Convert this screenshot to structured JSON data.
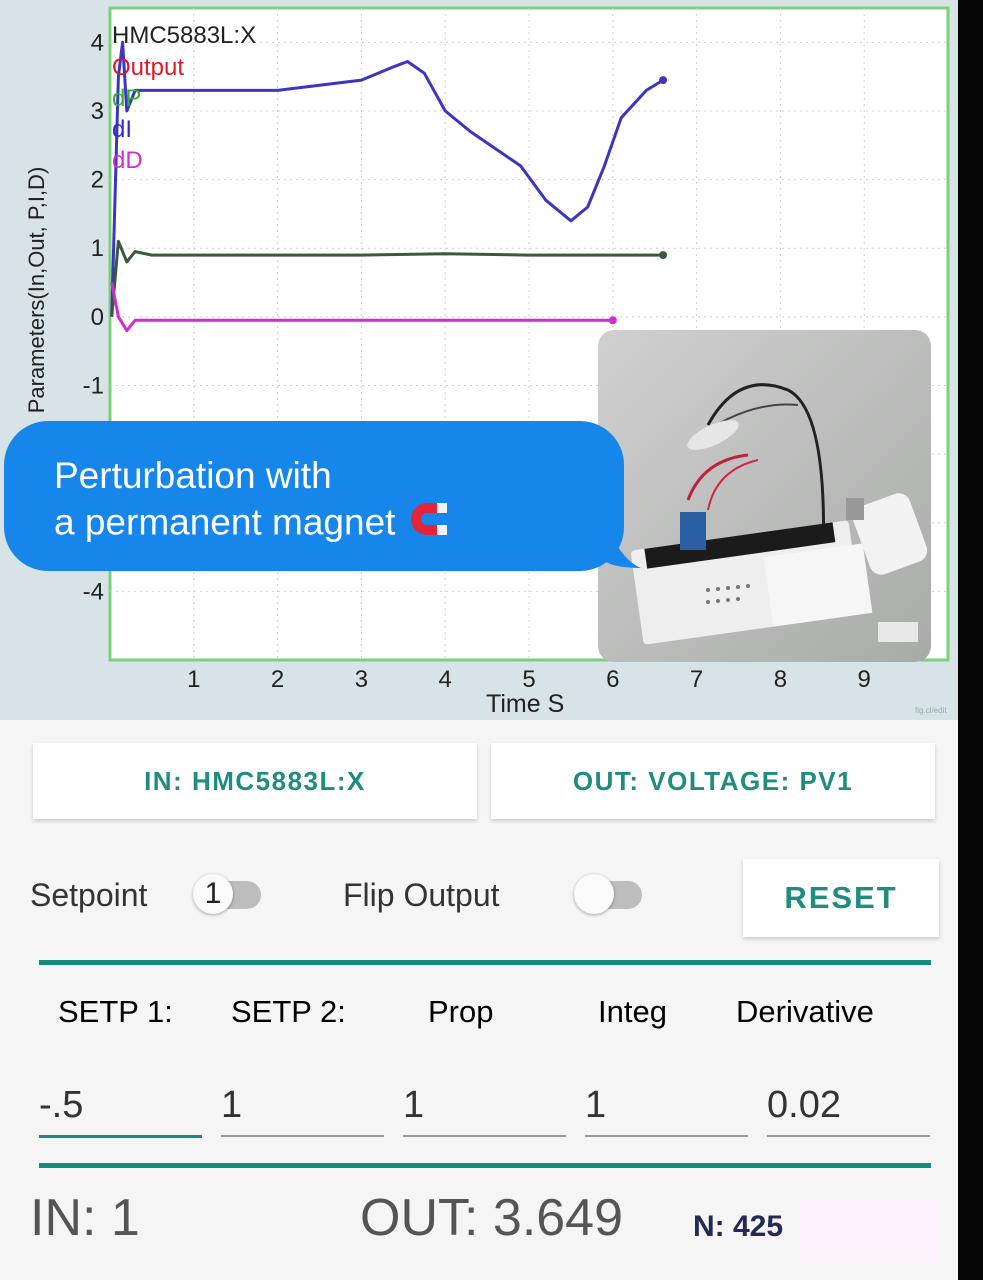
{
  "chart": {
    "title": "HMC5883L:X",
    "legend": [
      {
        "label": "Output",
        "color": "#e0182a"
      },
      {
        "label": "dP",
        "color": "#34b034"
      },
      {
        "label": "dI",
        "color": "#2c2cc8"
      },
      {
        "label": "dD",
        "color": "#d42ad4"
      }
    ],
    "ylabel": "Parameters(In,Out, P,I,D)",
    "xlabel": "Time S",
    "watermark": "fig.cl/edit",
    "xticks": [
      "1",
      "2",
      "3",
      "4",
      "5",
      "6",
      "7",
      "8",
      "9"
    ],
    "yticks": [
      "4",
      "3",
      "2",
      "1",
      "0",
      "-1",
      "-4"
    ],
    "grid": true
  },
  "chart_data": {
    "type": "line",
    "title": "HMC5883L:X",
    "xlabel": "Time S",
    "ylabel": "Parameters(In,Out, P,I,D)",
    "xlim": [
      0,
      10
    ],
    "ylim": [
      -5,
      4.5
    ],
    "series": [
      {
        "name": "Output",
        "color": "#3b35c0",
        "x": [
          0.02,
          0.1,
          0.15,
          0.2,
          0.3,
          0.5,
          1,
          2,
          3,
          3.4,
          3.55,
          3.75,
          4,
          4.3,
          4.6,
          4.9,
          5.2,
          5.5,
          5.7,
          5.9,
          6.1,
          6.4,
          6.6
        ],
        "y": [
          0,
          3.5,
          4.0,
          3.0,
          3.3,
          3.3,
          3.3,
          3.3,
          3.45,
          3.65,
          3.72,
          3.55,
          3.0,
          2.7,
          2.45,
          2.2,
          1.7,
          1.4,
          1.6,
          2.2,
          2.9,
          3.3,
          3.45
        ]
      },
      {
        "name": "dP",
        "color": "#3a5a3a",
        "x": [
          0.02,
          0.1,
          0.2,
          0.3,
          0.5,
          1,
          2,
          3,
          4,
          5,
          6,
          6.6
        ],
        "y": [
          0,
          1.1,
          0.8,
          0.95,
          0.9,
          0.9,
          0.9,
          0.9,
          0.92,
          0.9,
          0.9,
          0.9
        ]
      },
      {
        "name": "dD",
        "color": "#d42ad4",
        "x": [
          0.02,
          0.1,
          0.2,
          0.3,
          0.5,
          1,
          2,
          3,
          4,
          5,
          6
        ],
        "y": [
          0.5,
          0.0,
          -0.2,
          -0.05,
          -0.05,
          -0.05,
          -0.05,
          -0.05,
          -0.05,
          -0.05,
          -0.05
        ]
      }
    ]
  },
  "overlay": {
    "bubble_line1": "Perturbation with",
    "bubble_line2": "a permanent magnet",
    "icon": "magnet-icon"
  },
  "io": {
    "input": "IN: HMC5883L:X",
    "output": "OUT: VOLTAGE: PV1"
  },
  "controls": {
    "setpoint_label": "Setpoint",
    "setpoint_switch_value": "1",
    "flip_label": "Flip Output",
    "reset_label": "RESET"
  },
  "params": {
    "headers": [
      {
        "label": "SETP 1:",
        "color": "#555555"
      },
      {
        "label": "SETP 2:",
        "color": "#555555"
      },
      {
        "label": "Prop",
        "color": "#3ccf5c"
      },
      {
        "label": "Integ",
        "color": "#3a42c8"
      },
      {
        "label": "Derivative",
        "color": "#d62ad6"
      }
    ],
    "values": [
      "-.5",
      "1",
      "1",
      "1",
      "0.02"
    ]
  },
  "status": {
    "in": "IN: 1",
    "out": "OUT: 3.649",
    "n": "N: 425"
  }
}
